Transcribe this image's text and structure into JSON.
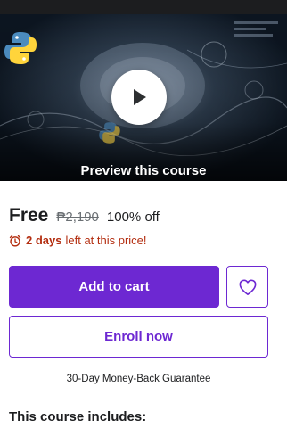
{
  "preview": {
    "label": "Preview this course",
    "play_icon": "play-icon",
    "logo_icon": "python-logo-icon"
  },
  "pricing": {
    "current": "Free",
    "original": "₱2,190",
    "discount": "100% off",
    "timer_icon": "alarm-clock-icon",
    "timer_bold": "2 days",
    "timer_text": "left at this price!"
  },
  "actions": {
    "add_to_cart": "Add to cart",
    "wishlist_icon": "heart-icon",
    "enroll": "Enroll now"
  },
  "guarantee": "30-Day Money-Back Guarantee",
  "includes_heading": "This course includes:",
  "colors": {
    "accent": "#6d28d2",
    "urgency": "#b32d0f",
    "text": "#1c1d1f",
    "muted": "#6a6f73"
  }
}
